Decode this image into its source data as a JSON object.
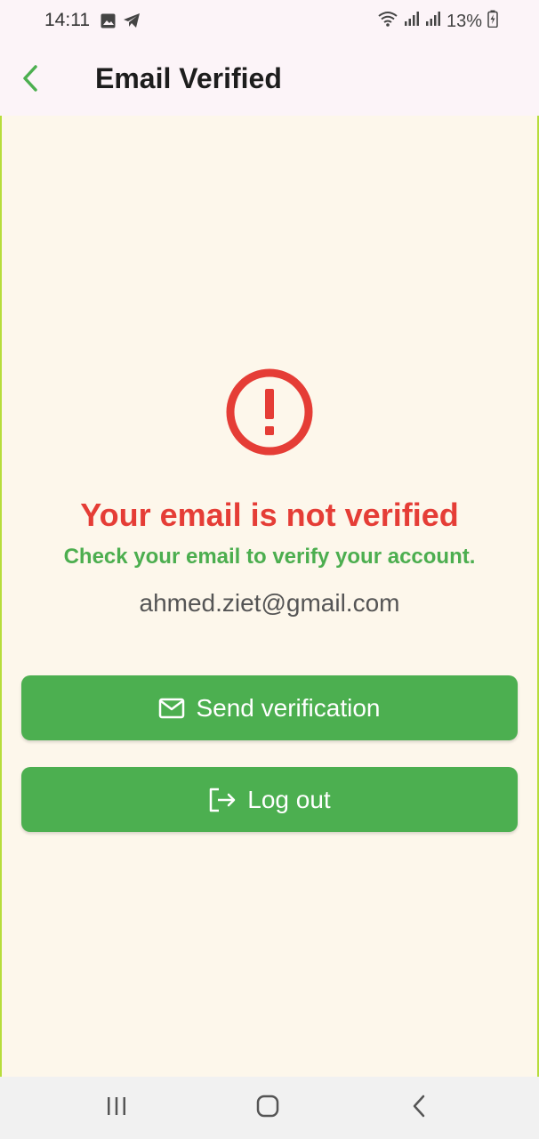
{
  "status_bar": {
    "time": "14:11",
    "battery": "13%",
    "icons": [
      "image-icon",
      "telegram-icon",
      "wifi-icon",
      "signal-icon",
      "signal-icon",
      "battery-charging-icon"
    ]
  },
  "app_bar": {
    "title": "Email Verified",
    "back_icon": "chevron-left-icon"
  },
  "main": {
    "alert_icon": "error-outline-icon",
    "headline": "Your email is not verified",
    "subline": "Check your email to verify your account.",
    "email": "ahmed.ziet@gmail.com"
  },
  "buttons": {
    "send_label": "Send verification",
    "send_icon": "mail-icon",
    "logout_label": "Log out",
    "logout_icon": "logout-icon"
  },
  "nav_bar": {
    "items": [
      "recents-icon",
      "home-icon",
      "back-icon"
    ]
  },
  "colors": {
    "accent_green": "#4caf50",
    "error_red": "#e53d36",
    "background": "#fdf7eb",
    "app_bar": "#fcf4f8"
  }
}
